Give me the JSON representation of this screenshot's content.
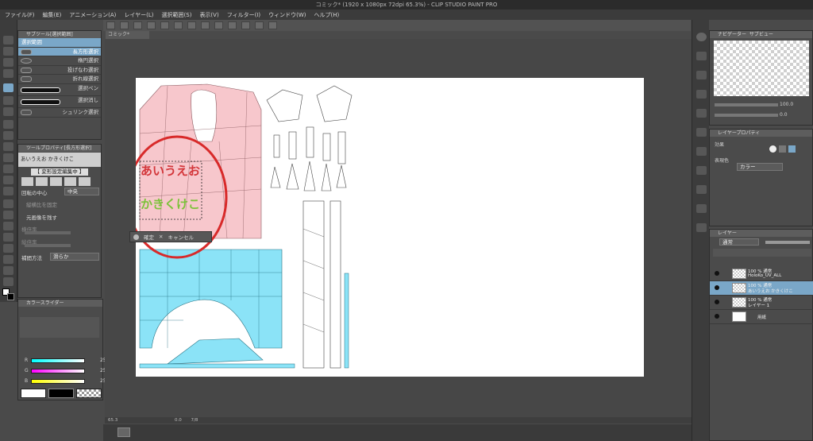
{
  "window": {
    "title": "コミック* (1920 x 1080px 72dpi 65.3%)  - CLIP STUDIO PAINT PRO"
  },
  "menu": [
    "ファイル(F)",
    "編集(E)",
    "アニメーション(A)",
    "レイヤー(L)",
    "選択範囲(S)",
    "表示(V)",
    "フィルター(I)",
    "ウィンドウ(W)",
    "ヘルプ(H)"
  ],
  "canvas_tab": "コミック*",
  "subtool": {
    "header": "サブツール[選択範囲]",
    "group": "選択範囲",
    "items": [
      "長方形選択",
      "楕円選択",
      "投げなわ選択",
      "折れ線選択",
      "選択ペン",
      "選択消し",
      "シュリンク選択"
    ]
  },
  "toolprop": {
    "header": "ツールプロパティ[長方形選択]",
    "mode_label": "あいうえお かきくけこ",
    "editing": "【 変形設定編集中 】",
    "center_label": "回転の中心",
    "center_value": "中央",
    "keep_ratio": "縦横比を固定",
    "keep_original": "元画像を残す",
    "width_label": "横倍率",
    "height_label": "縦倍率",
    "interp_label": "補間方法",
    "interp_value": "滑らか"
  },
  "color": {
    "header": "カラースライダー",
    "r_label": "R",
    "r_value": "255",
    "g_label": "G",
    "g_value": "255",
    "b_label": "B",
    "b_value": "255"
  },
  "canvas": {
    "text_line1": "あいうえお",
    "text_line2": "かきくけこ",
    "confirm": "確定",
    "cancel": "キャンセル",
    "line1_color": "#d3363a",
    "line2_color": "#7cc23a"
  },
  "status": {
    "zoom": "65.3",
    "angle": "0.0",
    "page": "7/8"
  },
  "navigator": {
    "header": "ナビゲーター",
    "tab2": "サブビュー",
    "zoom": "100.0",
    "angle": "0.0"
  },
  "layerprop": {
    "header": "レイヤープロパティ",
    "effect": "効果",
    "display_color_label": "表現色",
    "display_color_value": "カラー"
  },
  "layers": {
    "header": "レイヤー",
    "blend": "通常",
    "items": [
      {
        "line1": "100 % 通常",
        "line2": "HoloKo_UV_ALL",
        "selected": false
      },
      {
        "line1": "100 % 通常",
        "line2": "あいうえお かきくけこ",
        "selected": true
      },
      {
        "line1": "100 % 通常",
        "line2": "レイヤー 1",
        "selected": false
      },
      {
        "line1": "",
        "line2": "用紙",
        "selected": false
      }
    ]
  },
  "colors": {
    "selection_blue": "#7aa7c8",
    "uv_pink": "#f7c7cc",
    "uv_blue": "#8be3f7",
    "annotation_red": "#d82a2a"
  }
}
